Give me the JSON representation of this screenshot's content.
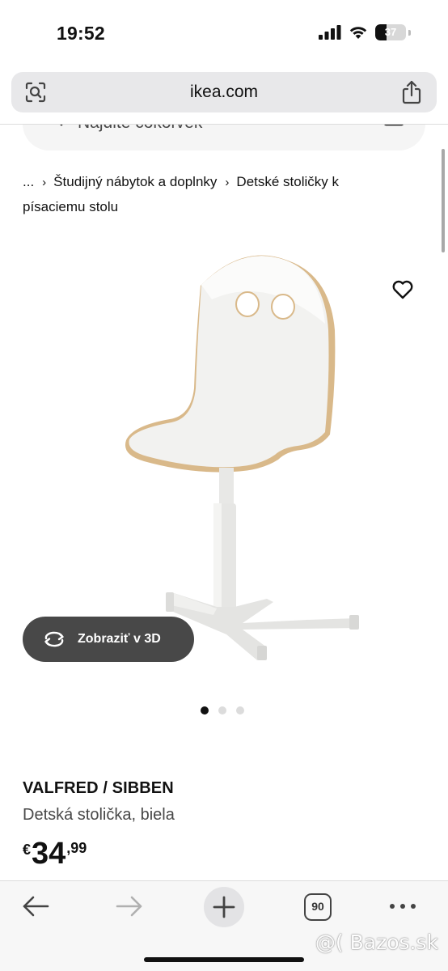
{
  "status": {
    "time": "19:52",
    "battery": "37",
    "battery_level": 0.37
  },
  "browser": {
    "url": "ikea.com"
  },
  "search": {
    "placeholder": "Nájdite čokoľvek"
  },
  "breadcrumb": {
    "items": [
      "...",
      "Študijný nábytok a doplnky",
      "Detské stoličky k písaciemu stolu"
    ]
  },
  "product": {
    "name": "VALFRED / SIBBEN",
    "description": "Detská stolička, biela",
    "price_currency": "€",
    "price_int": "34",
    "price_dec": ",99",
    "view3d_label": "Zobraziť v 3D",
    "image_count": 3,
    "active_image": 1
  },
  "toolbar": {
    "tab_count": "90"
  },
  "watermark": "@( Bazos.sk",
  "colors": {
    "accent_dark": "#484848",
    "background": "#ffffff",
    "plywood_edge": "#d9b98a"
  }
}
